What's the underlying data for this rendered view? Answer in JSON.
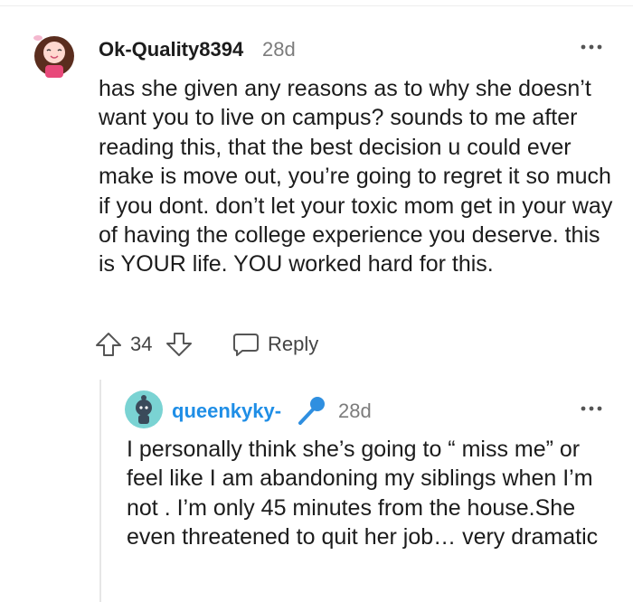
{
  "comment": {
    "username": "Ok-Quality8394",
    "time": "28d",
    "avatar_icon": "pink-snoo-avatar-icon",
    "body": "has she given any reasons as to why she doesn’t want you to live on campus? sounds to me after reading this, that the best decision u could ever make is move out, you’re going to regret it so much if you dont. don’t let your toxic mom get in your way of having the college experience you deserve. this is YOUR life. YOU worked hard for this.",
    "score": "34",
    "reply_label": "Reply"
  },
  "reply": {
    "username": "queenkyky-",
    "time": "28d",
    "avatar_icon": "teal-snoo-avatar-icon",
    "flair_icon": "microphone-icon",
    "body": "I personally think she’s going to “ miss me” or feel like I am abandoning my siblings when I’m not . I’m only 45 minutes from the house.She even threatened to quit her job… very dramatic"
  },
  "colors": {
    "username_link": "#1f8ee6",
    "muted": "#7c7c7c",
    "mic_blue": "#2f8fe0"
  }
}
